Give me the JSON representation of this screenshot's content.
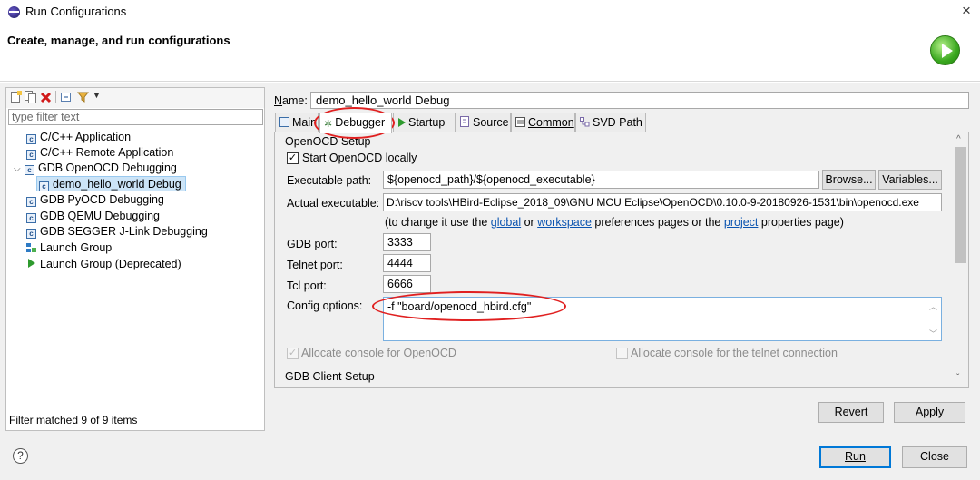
{
  "window": {
    "title": "Run Configurations",
    "close_glyph": "×"
  },
  "header": {
    "title": "Create, manage, and run configurations",
    "icon": "run-green-circle-icon"
  },
  "left": {
    "filter_placeholder": "type filter text",
    "tree": [
      {
        "label": "C/C++ Application",
        "icon": "c-launch-icon"
      },
      {
        "label": "C/C++ Remote Application",
        "icon": "c-launch-icon"
      },
      {
        "label": "GDB OpenOCD Debugging",
        "icon": "c-launch-icon",
        "expanded": true
      },
      {
        "label": "demo_hello_world Debug",
        "icon": "c-launch-icon",
        "selected": true
      },
      {
        "label": "GDB PyOCD Debugging",
        "icon": "c-launch-icon"
      },
      {
        "label": "GDB QEMU Debugging",
        "icon": "c-launch-icon"
      },
      {
        "label": "GDB SEGGER J-Link Debugging",
        "icon": "c-launch-icon"
      },
      {
        "label": "Launch Group",
        "icon": "launch-group-icon"
      },
      {
        "label": "Launch Group (Deprecated)",
        "icon": "play-icon"
      }
    ],
    "status": "Filter matched 9 of 9 items"
  },
  "name_label": "Name:",
  "name_value": "demo_hello_world Debug",
  "tabs": [
    "Main",
    "Debugger",
    "Startup",
    "Source",
    "Common",
    "SVD Path"
  ],
  "active_tab": "Debugger",
  "openocd": {
    "section_title": "OpenOCD Setup",
    "start_locally_label": "Start OpenOCD locally",
    "start_locally_checked": true,
    "exec_label": "Executable path:",
    "exec_value": "${openocd_path}/${openocd_executable}",
    "browse_label": "Browse...",
    "variables_label": "Variables...",
    "actual_label": "Actual executable:",
    "actual_value": "D:\\riscv tools\\HBird-Eclipse_2018_09\\GNU MCU Eclipse\\OpenOCD\\0.10.0-9-20180926-1531\\bin\\openocd.exe",
    "hint_prefix": "(to change it use the ",
    "hint_global": "global",
    "hint_or": " or ",
    "hint_workspace": "workspace",
    "hint_middle": " preferences pages or the ",
    "hint_project": "project",
    "hint_suffix": " properties page)",
    "gdb_port_label": "GDB port:",
    "gdb_port": "3333",
    "telnet_port_label": "Telnet port:",
    "telnet_port": "4444",
    "tcl_port_label": "Tcl port:",
    "tcl_port": "6666",
    "config_label": "Config options:",
    "config_value": "-f \"board/openocd_hbird.cfg\"",
    "alloc_console_label": "Allocate console for OpenOCD",
    "alloc_console_checked": true,
    "alloc_telnet_label": "Allocate console for the telnet connection",
    "alloc_telnet_checked": false
  },
  "gdb_client_section": "GDB Client Setup",
  "buttons": {
    "revert": "Revert",
    "apply": "Apply",
    "run": "Run",
    "close": "Close",
    "help": "?"
  },
  "colors": {
    "annotation": "#e02020",
    "link": "#0b54b0",
    "selection": "#cce4f7"
  }
}
